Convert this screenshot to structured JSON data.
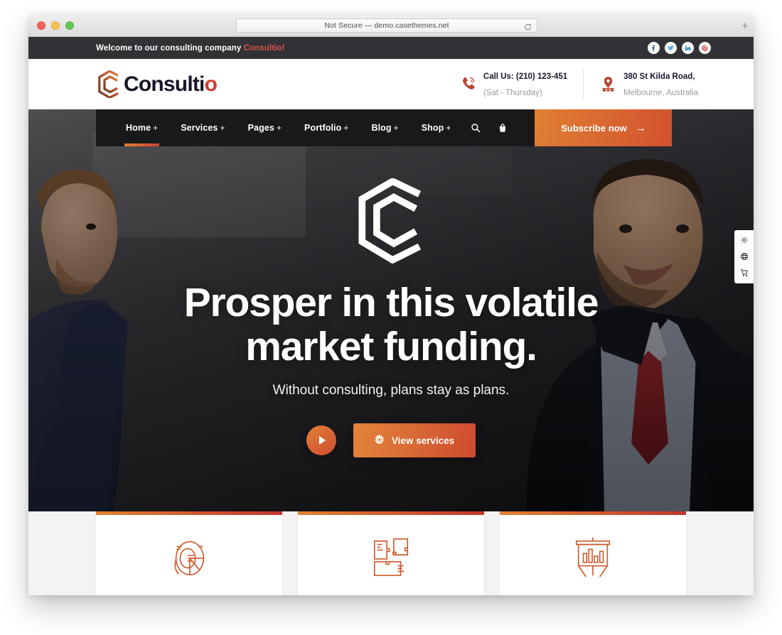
{
  "browser": {
    "url_text": "Not Secure — demo.casethemes.net",
    "reload_icon": "reload-icon",
    "new_tab_icon": "plus-icon",
    "traffic_lights": [
      "close-red",
      "minimize-yellow",
      "zoom-green"
    ]
  },
  "topbar": {
    "welcome_prefix": "Welcome to our consulting company ",
    "brand_word": "Consultio!",
    "socials": [
      {
        "name": "facebook-icon",
        "label": "Facebook",
        "color": "#3b5998"
      },
      {
        "name": "twitter-icon",
        "label": "Twitter",
        "color": "#55acee"
      },
      {
        "name": "linkedin-icon",
        "label": "LinkedIn",
        "color": "#0077b5"
      },
      {
        "name": "pinterest-icon",
        "label": "Pinterest",
        "color": "#cb2027"
      }
    ]
  },
  "header": {
    "logo_text_main": "Consulti",
    "logo_text_accent": "o",
    "contacts": [
      {
        "icon": "phone-icon",
        "top": "Call Us: (210) 123-451",
        "sub": "(Sat - Thursday)"
      },
      {
        "icon": "location-pin-icon",
        "top": "380 St Kilda Road,",
        "sub": "Melbourne, Australia"
      }
    ]
  },
  "nav": {
    "items": [
      {
        "label": "Home",
        "suffix": "+",
        "active": true
      },
      {
        "label": "Services",
        "suffix": "+",
        "active": false
      },
      {
        "label": "Pages",
        "suffix": "+",
        "active": false
      },
      {
        "label": "Portfolio",
        "suffix": "+",
        "active": false
      },
      {
        "label": "Blog",
        "suffix": "+",
        "active": false
      },
      {
        "label": "Shop",
        "suffix": "+",
        "active": false
      }
    ],
    "search_icon": "search-icon",
    "cart_icon": "shopping-bag-icon",
    "subscribe_label": "Subscribe now",
    "subscribe_arrow": "→"
  },
  "dock": {
    "items": [
      {
        "icon": "gear-icon",
        "label": "Settings"
      },
      {
        "icon": "globe-icon",
        "label": "Language"
      },
      {
        "icon": "cart-icon",
        "label": "Cart"
      }
    ]
  },
  "hero": {
    "logo_watermark": "consultio-c-mark",
    "heading": "Prosper in this volatile market funding.",
    "subheading": "Without consulting, plans stay as plans.",
    "play_button_label": "play-button",
    "cta_label": "View services",
    "cta_icon": "gear-icon"
  },
  "cards": [
    {
      "icon": "pie-chart-icon",
      "name": "card-pie-chart"
    },
    {
      "icon": "puzzle-pieces-icon",
      "name": "card-puzzle"
    },
    {
      "icon": "presentation-chart-icon",
      "name": "card-presentation"
    }
  ],
  "colors": {
    "accent_orange": "#e0822f",
    "accent_red": "#c3352e",
    "nav_dark": "#19191c",
    "topbar_dark": "#323236",
    "brand_text": "#141727"
  }
}
